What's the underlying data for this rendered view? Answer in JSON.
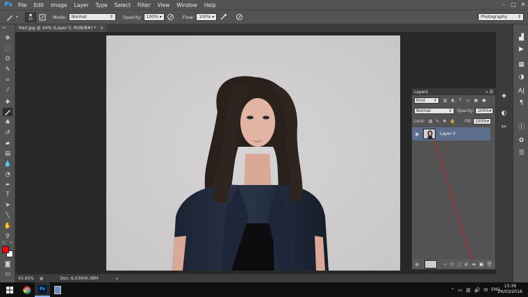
{
  "app": {
    "logo": "Ps"
  },
  "menu": [
    "File",
    "Edit",
    "Image",
    "Layer",
    "Type",
    "Select",
    "Filter",
    "View",
    "Window",
    "Help"
  ],
  "window_controls": {
    "minimize": "–",
    "maximize": "□",
    "close": "✕"
  },
  "options": {
    "brush_size": "15",
    "mode_label": "Mode:",
    "mode_value": "Normal",
    "opacity_label": "Opacity:",
    "opacity_value": "100%",
    "flow_label": "Flow:",
    "flow_value": "100%",
    "workspace": "Photography"
  },
  "document_tab": {
    "title": "Hair.jpg @ 44% (Layer 0, RGB/8#) *",
    "close": "×"
  },
  "status": {
    "zoom": "43.95%",
    "doc": "Doc: 6.03M/9.08M"
  },
  "layers_panel": {
    "title": "Layers",
    "filter_label": "Kind",
    "blend_mode": "Normal",
    "opacity_label": "Opacity:",
    "opacity_value": "100%",
    "lock_label": "Lock:",
    "fill_label": "Fill:",
    "fill_value": "100%",
    "layer_name": "Layer 0"
  },
  "taskbar": {
    "language": "ENG",
    "time": "13:39",
    "date": "24/03/2016"
  },
  "colors": {
    "foreground": "#ff0000",
    "background": "#ffffff",
    "selected_layer": "#5c6e8b",
    "annotation": "#cc1a1a"
  },
  "tools": [
    "move-icon",
    "marquee-icon",
    "lasso-icon",
    "quick-select-icon",
    "crop-icon",
    "eyedropper-icon",
    "healing-icon",
    "brush-icon",
    "stamp-icon",
    "history-brush-icon",
    "eraser-icon",
    "gradient-icon",
    "blur-icon",
    "dodge-icon",
    "pen-icon",
    "type-icon",
    "path-select-icon",
    "shape-icon",
    "hand-icon",
    "zoom-icon"
  ]
}
